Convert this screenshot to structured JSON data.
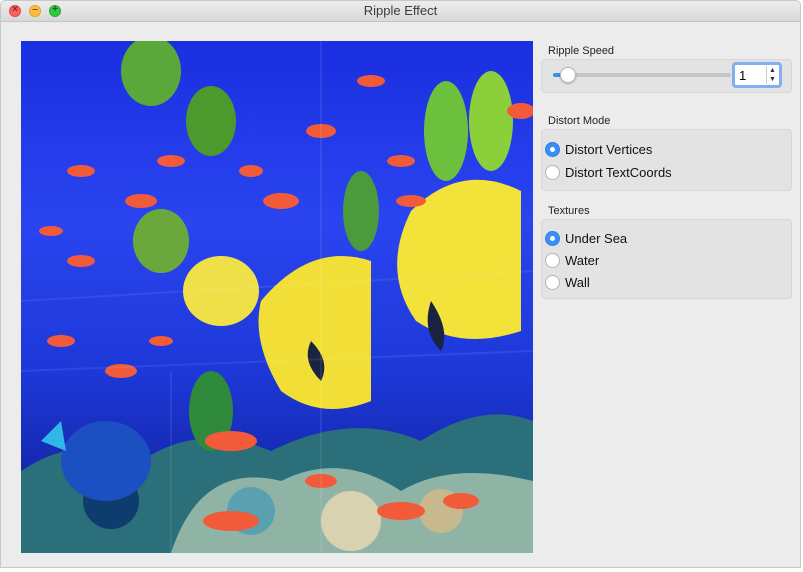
{
  "window": {
    "title": "Ripple Effect"
  },
  "ripple_speed": {
    "label": "Ripple Speed",
    "slider_value": 1,
    "slider_min": 1,
    "slider_max": 100,
    "spin_value": "1"
  },
  "distort_mode": {
    "label": "Distort Mode",
    "options": [
      {
        "label": "Distort Vertices",
        "checked": true
      },
      {
        "label": "Distort TextCoords",
        "checked": false
      }
    ]
  },
  "textures": {
    "label": "Textures",
    "options": [
      {
        "label": "Under Sea",
        "checked": true
      },
      {
        "label": "Water",
        "checked": false
      },
      {
        "label": "Wall",
        "checked": false
      }
    ]
  },
  "colors": {
    "accent": "#3a8ef5",
    "water": "#1f3ae6"
  }
}
